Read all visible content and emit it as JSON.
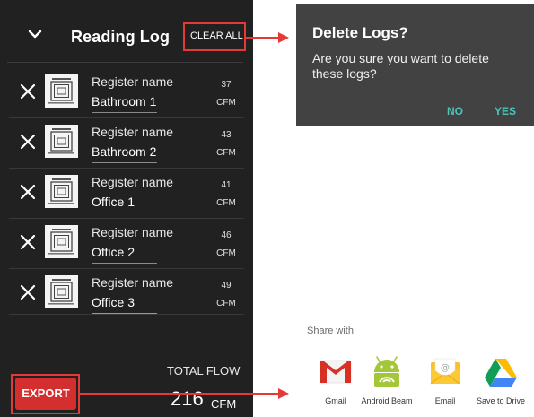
{
  "header": {
    "title": "Reading Log",
    "clear_all": "CLEAR ALL"
  },
  "rows": [
    {
      "name_label": "Register name",
      "name_value": "Bathroom 1",
      "flow": "37",
      "unit": "CFM"
    },
    {
      "name_label": "Register name",
      "name_value": "Bathroom 2",
      "flow": "43",
      "unit": "CFM"
    },
    {
      "name_label": "Register name",
      "name_value": "Office 1",
      "flow": "41",
      "unit": "CFM"
    },
    {
      "name_label": "Register name",
      "name_value": "Office 2",
      "flow": "46",
      "unit": "CFM"
    },
    {
      "name_label": "Register name",
      "name_value": "Office 3",
      "flow": "49",
      "unit": "CFM"
    }
  ],
  "total": {
    "label": "TOTAL FLOW",
    "value": "216",
    "unit": "CFM"
  },
  "export_label": "EXPORT",
  "dialog": {
    "title": "Delete Logs?",
    "message": "Are you sure you want to delete these logs?",
    "no": "NO",
    "yes": "YES"
  },
  "share": {
    "title": "Share with",
    "items": [
      {
        "label": "Gmail",
        "icon": "gmail-icon"
      },
      {
        "label": "Android Beam",
        "icon": "android-beam-icon"
      },
      {
        "label": "Email",
        "icon": "email-icon"
      },
      {
        "label": "Save to Drive",
        "icon": "drive-icon"
      }
    ]
  },
  "colors": {
    "panel_bg": "#212121",
    "dialog_bg": "#424242",
    "accent": "#4fc3b8",
    "export": "#d32f2f",
    "callout": "#e53935"
  }
}
